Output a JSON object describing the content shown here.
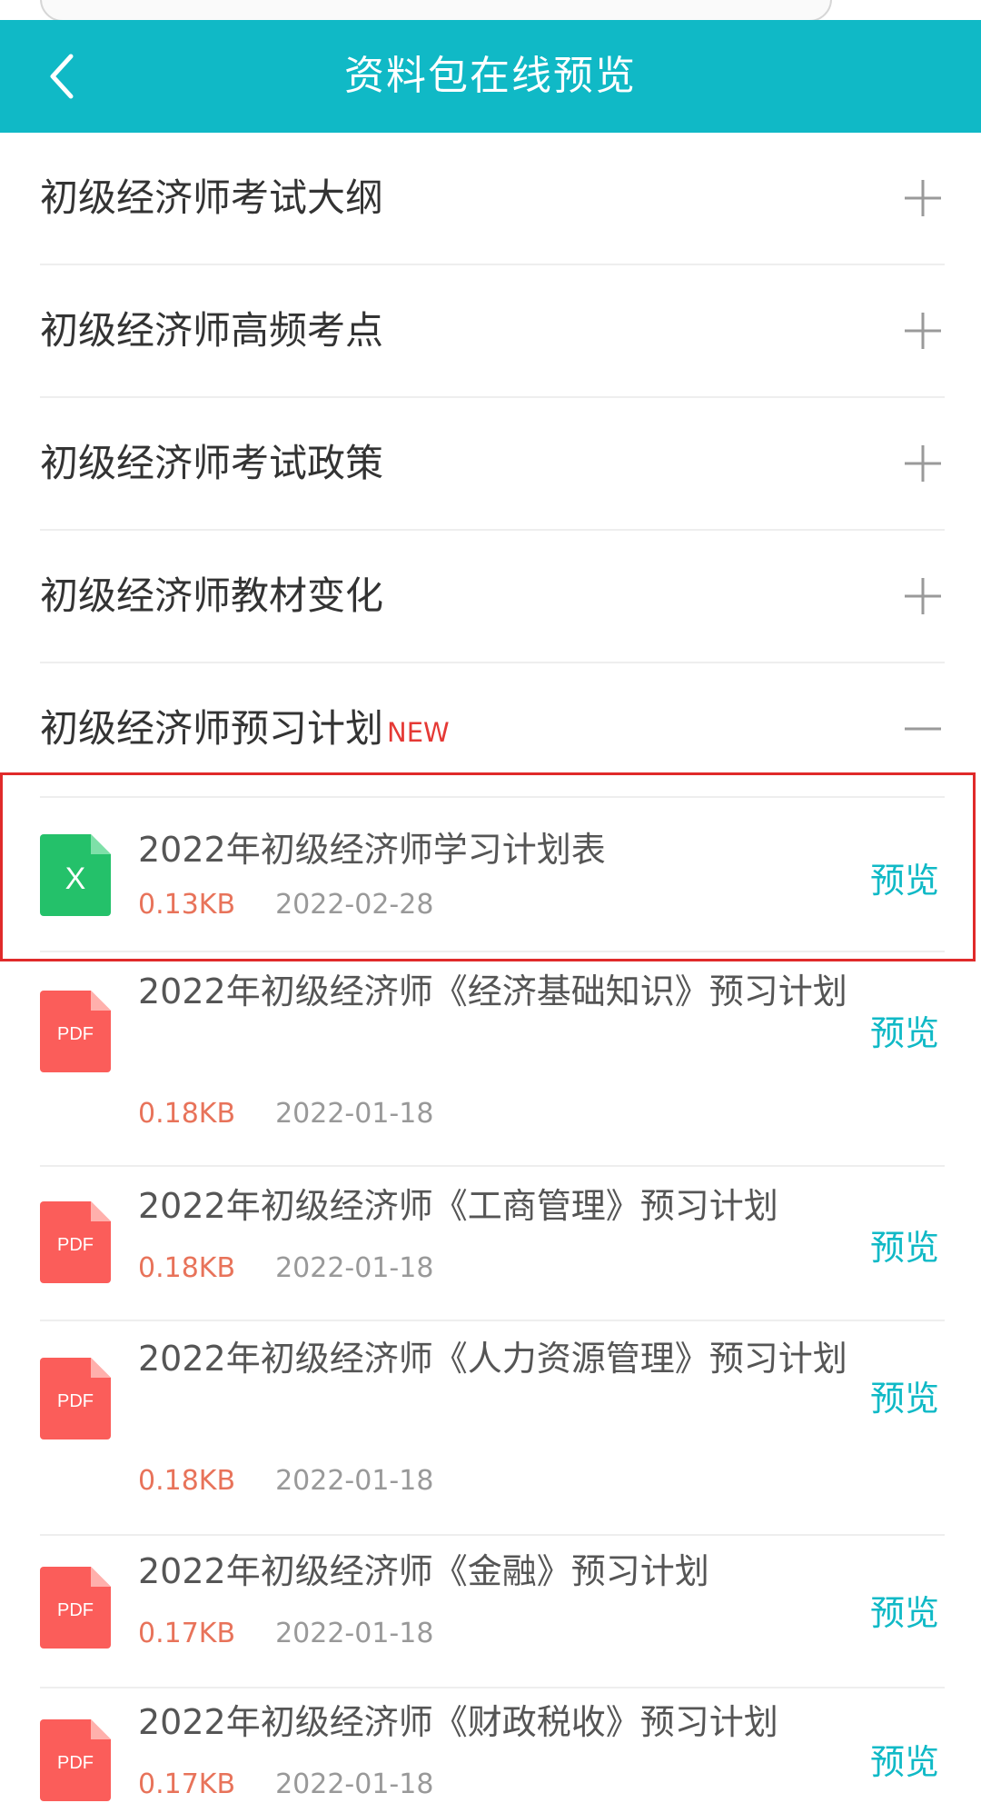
{
  "colors": {
    "header_bg": "#10b9c6",
    "accent": "#10b9c6",
    "size_text": "#e8735a",
    "new_badge": "#e53935",
    "excel_icon": "#24c16a",
    "pdf_icon": "#fb5d5a",
    "highlight_border": "#e02a2a"
  },
  "header": {
    "title": "资料包在线预览",
    "back_icon": "chevron-left-icon"
  },
  "sections": [
    {
      "label": "初级经济师考试大纲",
      "expanded": false,
      "toggle_icon": "plus-icon"
    },
    {
      "label": "初级经济师高频考点",
      "expanded": false,
      "toggle_icon": "plus-icon"
    },
    {
      "label": "初级经济师考试政策",
      "expanded": false,
      "toggle_icon": "plus-icon"
    },
    {
      "label": "初级经济师教材变化",
      "expanded": false,
      "toggle_icon": "plus-icon"
    },
    {
      "label": "初级经济师预习计划",
      "badge": "NEW",
      "expanded": true,
      "toggle_icon": "minus-icon"
    }
  ],
  "files": [
    {
      "type": "xlsx",
      "icon_text": "X",
      "name": "2022年初级经济师学习计划表",
      "size": "0.13KB",
      "date": "2022-02-28",
      "action": "预览",
      "highlighted": true
    },
    {
      "type": "pdf",
      "icon_text": "PDF",
      "name": "2022年初级经济师《经济基础知识》预习计划",
      "size": "0.18KB",
      "date": "2022-01-18",
      "action": "预览"
    },
    {
      "type": "pdf",
      "icon_text": "PDF",
      "name": "2022年初级经济师《工商管理》预习计划",
      "size": "0.18KB",
      "date": "2022-01-18",
      "action": "预览"
    },
    {
      "type": "pdf",
      "icon_text": "PDF",
      "name": "2022年初级经济师《人力资源管理》预习计划",
      "size": "0.18KB",
      "date": "2022-01-18",
      "action": "预览"
    },
    {
      "type": "pdf",
      "icon_text": "PDF",
      "name": "2022年初级经济师《金融》预习计划",
      "size": "0.17KB",
      "date": "2022-01-18",
      "action": "预览"
    },
    {
      "type": "pdf",
      "icon_text": "PDF",
      "name": "2022年初级经济师《财政税收》预习计划",
      "size": "0.17KB",
      "date": "2022-01-18",
      "action": "预览"
    }
  ]
}
